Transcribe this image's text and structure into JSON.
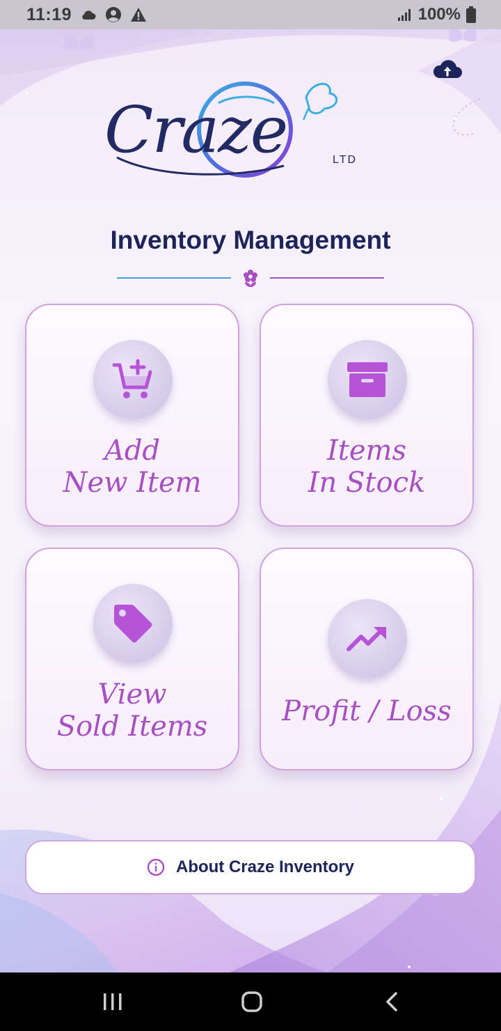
{
  "status_bar": {
    "time": "11:19",
    "battery": "100%",
    "icons": [
      "cloud-icon",
      "account-circle-icon",
      "warning-icon",
      "signal-icon",
      "battery-icon"
    ]
  },
  "header": {
    "logo_text": "Craze",
    "logo_subtext": "LTD",
    "upload_icon": "cloud-upload-icon"
  },
  "title": "Inventory Management",
  "cards": [
    {
      "id": "add",
      "line1": "Add",
      "line2": "New Item",
      "icon": "cart-plus-icon"
    },
    {
      "id": "stock",
      "line1": "Items",
      "line2": "In Stock",
      "icon": "archive-box-icon"
    },
    {
      "id": "sold",
      "line1": "View",
      "line2": "Sold Items",
      "icon": "tag-icon"
    },
    {
      "id": "profit",
      "line1": "Profit / Loss",
      "line2": "",
      "icon": "trending-up-icon"
    }
  ],
  "about_button": {
    "label": "About Craze Inventory",
    "icon": "info-icon"
  },
  "colors": {
    "primary_text": "#1c2459",
    "accent_purple": "#a94fc4",
    "icon_purple": "#b653d6",
    "card_border": "#cfa2de",
    "divider_blue": "#4a9fd8"
  },
  "nav_bar": [
    "recents-icon",
    "home-icon",
    "back-icon"
  ]
}
